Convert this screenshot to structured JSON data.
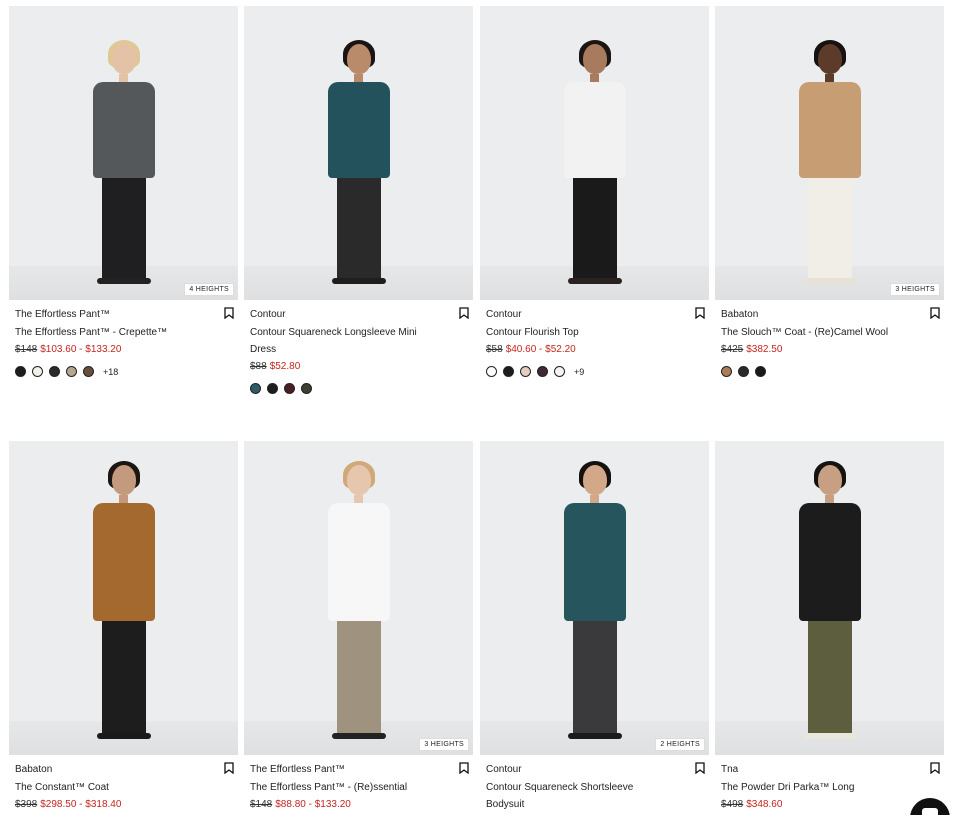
{
  "products": [
    {
      "brand": "The Effortless Pant™",
      "name": "The Effortless Pant™ - Crepette™",
      "price_was": "$148",
      "price_now": "$103.60 - $133.20",
      "badge": "4 HEIGHTS",
      "swatches": [
        "#1d1d1d",
        "#f3f1ea",
        "#2a2a2e",
        "#b4a78f",
        "#6a4e3c"
      ],
      "more": "+18",
      "model": {
        "skin": "#e4c2a8",
        "hair": "#e0c896",
        "top": "#54585a",
        "bottom": "#1f1f21",
        "shoe": "#222"
      }
    },
    {
      "brand": "Contour",
      "name": "Contour Squareneck Longsleeve Mini Dress",
      "price_was": "$88",
      "price_now": "$52.80",
      "badge": "",
      "swatches": [
        "#2f5b66",
        "#1d1d1d",
        "#4a1f22",
        "#3b4030"
      ],
      "more": "",
      "model": {
        "skin": "#b98b6b",
        "hair": "#1a1412",
        "top": "#23525c",
        "bottom": "#2b2a2a",
        "shoe": "#1e1e1e"
      }
    },
    {
      "brand": "Contour",
      "name": "Contour Flourish Top",
      "price_was": "$58",
      "price_now": "$40.60 - $52.20",
      "badge": "",
      "swatches": [
        "#ffffff",
        "#1d1d1d",
        "#e4cdbd",
        "#3f2a33",
        "#f4f4f4"
      ],
      "more": "+9",
      "model": {
        "skin": "#a87a5e",
        "hair": "#1b1613",
        "top": "#f2f2f2",
        "bottom": "#1a1a1a",
        "shoe": "#2a2220"
      }
    },
    {
      "brand": "Babaton",
      "name": "The Slouch™ Coat - (Re)Camel Wool",
      "price_was": "$425",
      "price_now": "$382.50",
      "badge": "3 HEIGHTS",
      "swatches": [
        "#a97c5a",
        "#2a2a2a",
        "#1a1a1a"
      ],
      "more": "",
      "model": {
        "skin": "#5c3b2a",
        "hair": "#161210",
        "top": "#c79d74",
        "bottom": "#f1eee8",
        "shoe": "#e7e2d8"
      }
    },
    {
      "brand": "Babaton",
      "name": "The Constant™ Coat",
      "price_was": "$398",
      "price_now": "$298.50 - $318.40",
      "badge": "",
      "swatches": [],
      "more": "",
      "model": {
        "skin": "#c39a7e",
        "hair": "#1b1612",
        "top": "#a4692f",
        "bottom": "#1d1d1d",
        "shoe": "#1a1a1a"
      }
    },
    {
      "brand": "The Effortless Pant™",
      "name": "The Effortless Pant™ - (Re)ssential",
      "price_was": "$148",
      "price_now": "$88.80 - $133.20",
      "badge": "3 HEIGHTS",
      "swatches": [],
      "more": "",
      "model": {
        "skin": "#e6c6ad",
        "hair": "#cfa97a",
        "top": "#f7f7f7",
        "bottom": "#9f927f",
        "shoe": "#222"
      }
    },
    {
      "brand": "Contour",
      "name": "Contour Squareneck Shortsleeve Bodysuit",
      "price_was": "",
      "price_now": "",
      "badge": "2 HEIGHTS",
      "swatches": [],
      "more": "",
      "model": {
        "skin": "#d2a888",
        "hair": "#15110f",
        "top": "#27555e",
        "bottom": "#3a3a3c",
        "shoe": "#1b1b1b"
      }
    },
    {
      "brand": "Tna",
      "name": "The Powder Dri Parka™ Long",
      "price_was": "$498",
      "price_now": "$348.60",
      "badge": "",
      "swatches": [],
      "more": "",
      "model": {
        "skin": "#c79f82",
        "hair": "#161210",
        "top": "#1c1c1d",
        "bottom": "#5d5e3e",
        "shoe": "#e9e6dc"
      }
    }
  ]
}
